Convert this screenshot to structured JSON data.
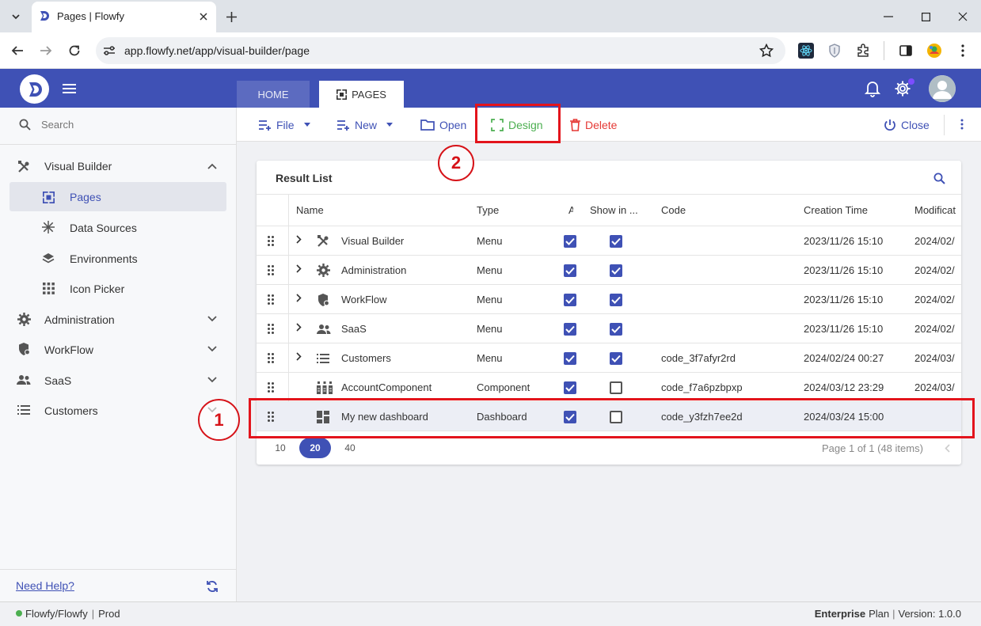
{
  "browser": {
    "tab_title": "Pages | Flowfy",
    "url": "app.flowfy.net/app/visual-builder/page"
  },
  "header": {
    "tabs": [
      {
        "label": "HOME",
        "active": false
      },
      {
        "label": "PAGES",
        "active": true
      }
    ]
  },
  "search": {
    "placeholder": "Search"
  },
  "sidebar": {
    "items": [
      {
        "label": "Visual Builder",
        "icon": "tools-icon",
        "expanded": true
      },
      {
        "label": "Pages",
        "icon": "pages-icon",
        "selected": true
      },
      {
        "label": "Data Sources",
        "icon": "snowflake-icon"
      },
      {
        "label": "Environments",
        "icon": "layers-icon"
      },
      {
        "label": "Icon Picker",
        "icon": "grid-icon"
      },
      {
        "label": "Administration",
        "icon": "gear-icon"
      },
      {
        "label": "WorkFlow",
        "icon": "shield-icon"
      },
      {
        "label": "SaaS",
        "icon": "people-icon"
      },
      {
        "label": "Customers",
        "icon": "list-icon"
      }
    ],
    "help_link": "Need Help?"
  },
  "toolbar": {
    "file_label": "File",
    "new_label": "New",
    "open_label": "Open",
    "design_label": "Design",
    "delete_label": "Delete",
    "close_label": "Close"
  },
  "result_list": {
    "title": "Result List",
    "columns": [
      "Name",
      "Type",
      "A",
      "Show in ...",
      "Code",
      "Creation Time",
      "Modificat"
    ],
    "rows": [
      {
        "name": "Visual Builder",
        "icon": "tools-icon",
        "expandable": true,
        "type": "Menu",
        "a": true,
        "show": true,
        "code": "",
        "created": "2023/11/26 15:10",
        "modified": "2024/02/"
      },
      {
        "name": "Administration",
        "icon": "gear-icon",
        "expandable": true,
        "type": "Menu",
        "a": true,
        "show": true,
        "code": "",
        "created": "2023/11/26 15:10",
        "modified": "2024/02/"
      },
      {
        "name": "WorkFlow",
        "icon": "shield-icon",
        "expandable": true,
        "type": "Menu",
        "a": true,
        "show": true,
        "code": "",
        "created": "2023/11/26 15:10",
        "modified": "2024/02/"
      },
      {
        "name": "SaaS",
        "icon": "people-icon",
        "expandable": true,
        "type": "Menu",
        "a": true,
        "show": true,
        "code": "",
        "created": "2023/11/26 15:10",
        "modified": "2024/02/"
      },
      {
        "name": "Customers",
        "icon": "list-icon",
        "expandable": true,
        "type": "Menu",
        "a": true,
        "show": true,
        "code": "code_3f7afyr2rd",
        "created": "2024/02/24 00:27",
        "modified": "2024/03/"
      },
      {
        "name": "AccountComponent",
        "icon": "component-icon",
        "expandable": false,
        "type": "Component",
        "a": true,
        "show": false,
        "code": "code_f7a6pzbpxp",
        "created": "2024/03/12 23:29",
        "modified": "2024/03/"
      },
      {
        "name": "My new dashboard",
        "icon": "dashboard-icon",
        "expandable": false,
        "type": "Dashboard",
        "a": true,
        "show": false,
        "code": "code_y3fzh7ee2d",
        "created": "2024/03/24 15:00",
        "modified": ""
      }
    ],
    "page_sizes": [
      "10",
      "20",
      "40"
    ],
    "selected_page_size": "20",
    "pagination": "Page 1 of 1 (48 items)"
  },
  "annotations": [
    "1",
    "2"
  ],
  "footer": {
    "env": "Flowfy/Flowfy",
    "separator": "|",
    "env_stage": "Prod",
    "plan_bold": "Enterprise",
    "plan_rest": "Plan",
    "version": "Version: 1.0.0"
  },
  "colors": {
    "primary": "#3f51b5",
    "design": "#4caf50",
    "delete": "#e53935",
    "annotation": "#e3141c"
  }
}
